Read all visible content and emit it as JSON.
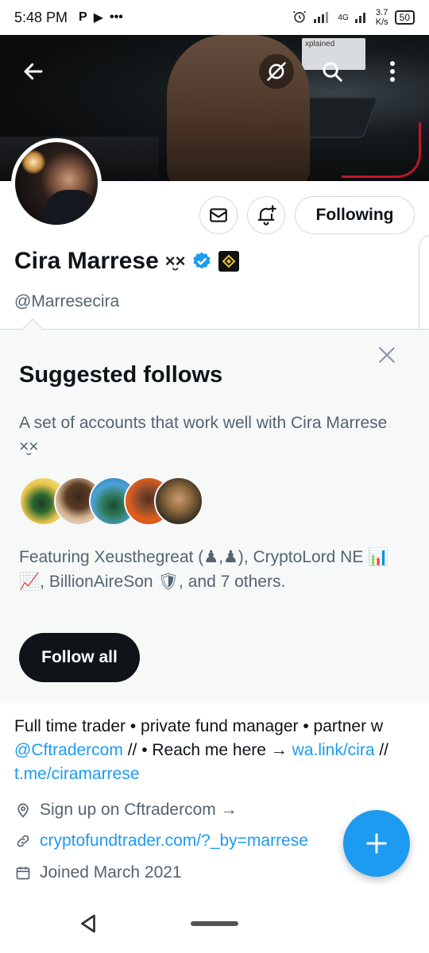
{
  "status_bar": {
    "time": "5:48 PM",
    "left_icons": [
      "P",
      "▶",
      "•••"
    ],
    "network_label": "4G",
    "speed_value": "3.7",
    "speed_unit": "K/s",
    "battery": "50"
  },
  "banner": {
    "monitor_text": "xplained"
  },
  "profile": {
    "display_name": "Cira Marrese",
    "name_emoji": "×̮×",
    "handle": "@Marresecira",
    "following_label": "Following"
  },
  "suggested": {
    "title": "Suggested follows",
    "description": "A set of accounts that work well with Cira Marrese ×̮×",
    "featuring": "Featuring Xeusthegreat (♟,♟), CryptoLord NE 📊📈, BillionAireSon 🛡, and 7 others.",
    "follow_all_label": "Follow all"
  },
  "bio": {
    "part1": "Full time trader • private fund manager • partner w ",
    "mention": "@Cftradercom",
    "part2": " // • Reach me here → ",
    "link1": "wa.link/cira",
    "part3": " // ",
    "link2": "t.me/ciramarrese"
  },
  "meta": {
    "location": "Sign up on Cftradercom →",
    "url": "cryptofundtrader.com/?_by=marrese",
    "joined": "Joined March 2021"
  },
  "colors": {
    "accent": "#1d9bf0",
    "text_primary": "#0f1419",
    "text_secondary": "#536471",
    "card_bg": "#f7f9f9"
  },
  "icons": [
    "back-arrow-icon",
    "no-satellite-icon",
    "search-icon",
    "more-vertical-icon",
    "mail-icon",
    "bell-plus-icon",
    "verified-badge-icon",
    "affiliate-badge-icon",
    "close-icon",
    "location-icon",
    "link-icon",
    "calendar-icon",
    "compose-plus-icon",
    "nav-back-icon"
  ]
}
